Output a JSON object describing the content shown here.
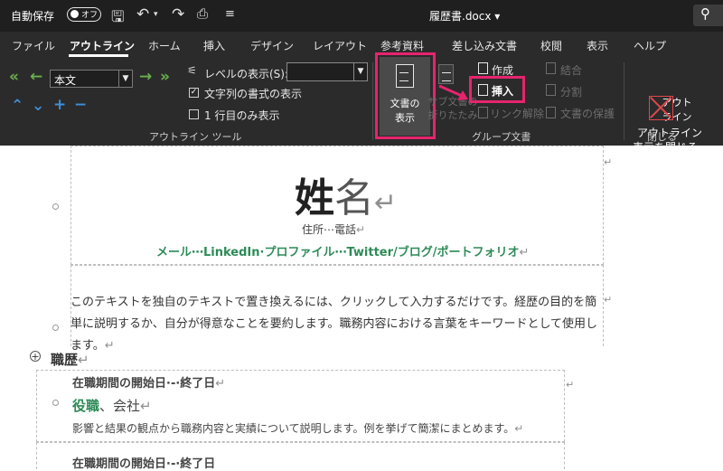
{
  "titlebar": {
    "autosave": "自動保存",
    "toggle": "オフ",
    "save_icon": "save-icon",
    "undo_icon": "undo-icon",
    "redo_icon": "redo-icon",
    "doc_title": "履歴書.docx ▾"
  },
  "ribbon": {
    "tabs": [
      "ファイル",
      "アウトライン",
      "ホーム",
      "挿入",
      "デザイン",
      "レイアウト",
      "参考資料",
      "差し込み文書",
      "校閲",
      "表示",
      "ヘルプ"
    ],
    "active_tab": "アウトライン",
    "outline_tools": {
      "style_value": "本文",
      "level_label": "レベルの表示(S):",
      "level_value": "",
      "show_text_format": "文字列の書式の表示",
      "show_text_format_checked": true,
      "first_line_only": "1 行目のみ表示",
      "first_line_only_checked": false,
      "group_label": "アウトライン ツール"
    },
    "master_doc": {
      "show_doc_line1": "文書の",
      "show_doc_line2": "表示",
      "collapse_line1": "サブ文書の",
      "collapse_line2": "折りたたみ",
      "create": "作成",
      "insert": "挿入",
      "unlink": "リンク解除",
      "merge": "結合",
      "split": "分割",
      "lock": "文書の保護",
      "group_label": "グループ文書"
    },
    "close": {
      "line1": "アウトライン",
      "line2": "表示を閉じる",
      "group_label": "閉じる"
    }
  },
  "document": {
    "name_bold": "姓",
    "name_rest": "名",
    "address": "住所⋯電話",
    "contact": "メール⋯LinkedIn·プロファイル⋯Twitter/ブログ/ポートフォリオ",
    "body": "このテキストを独自のテキストで置き換えるには、クリックして入力するだけです。経歴の目的を簡単に説明するか、自分が得意なことを要約します。職務内容における言葉をキーワードとして使用します。",
    "section_heading": "職歴",
    "period": "在職期間の開始日⋅-⋅終了日",
    "role_title": "役職",
    "role_company": "、会社",
    "description": "影響と結果の観点から職務内容と実績について説明します。例を挙げて簡潔にまとめます。",
    "period2": "在職期間の開始日⋅-⋅終了日"
  },
  "colors": {
    "highlight": "#e6246e",
    "accent_green": "#2e8b57",
    "ribbon_bg": "#2b2b2b"
  }
}
